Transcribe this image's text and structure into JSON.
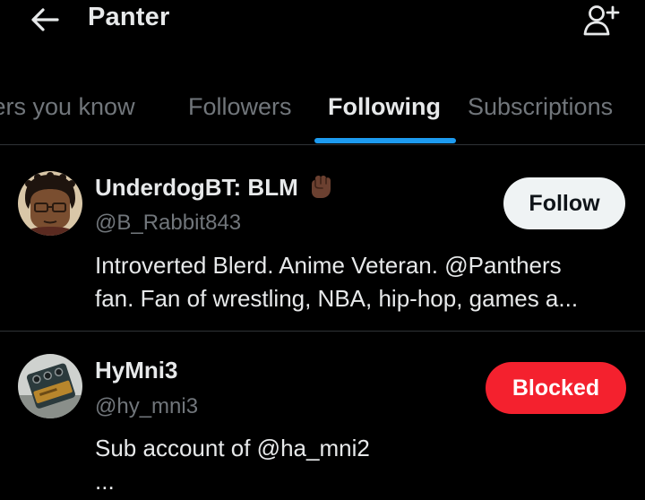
{
  "header": {
    "title": "Panter",
    "back_icon": "arrow-left-icon",
    "add_icon": "person-add-icon"
  },
  "tabs": [
    {
      "label": "Followers you know",
      "visible_text": "wers you know",
      "active": false
    },
    {
      "label": "Followers",
      "active": false
    },
    {
      "label": "Following",
      "active": true
    },
    {
      "label": "Subscriptions",
      "active": false
    }
  ],
  "users": [
    {
      "display_name": "UnderdogBT: BLM",
      "emoji": "raised-fist-icon",
      "handle": "@B_Rabbit843",
      "bio_line1": "Introverted Blerd. Anime Veteran. @Panthers",
      "bio_line2": "fan. Fan of wrestling, NBA, hip-hop, games a...",
      "button_label": "Follow"
    },
    {
      "display_name": "HyMni3",
      "handle": "@hy_mni3",
      "bio_line1": "Sub account of @ha_mni2",
      "bio_line2": "...",
      "button_label": "Blocked"
    }
  ],
  "colors": {
    "background": "#000000",
    "text_primary": "#e7e9ea",
    "text_secondary": "#71767b",
    "accent": "#1d9bf0",
    "blocked": "#f4212e",
    "divider": "#2f3336"
  }
}
